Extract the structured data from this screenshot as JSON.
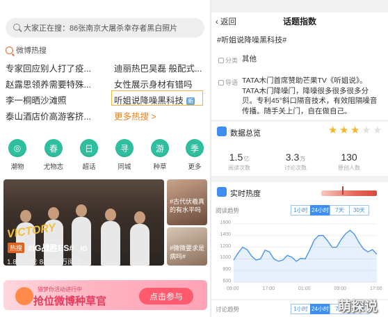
{
  "left": {
    "search_text": "大家正在搜：86张南京大屠杀幸存者黑白照片",
    "hot_header": "微博热搜",
    "hot_items": [
      "专家回应别人打了疫...",
      "迪丽热巴吴磊 般配式...",
      "赵露思领养需要特殊...",
      "女性展示身材有错吗",
      "李一桐晒沙滩照",
      "听姐说降噪黑科技",
      "泰山酒店价高游客挤...",
      "更多热搜 >"
    ],
    "new_badge": "新",
    "categories": [
      {
        "glyph": "◎",
        "label": "潮物"
      },
      {
        "glyph": "春",
        "label": "尤物志"
      },
      {
        "glyph": "日",
        "label": "超话"
      },
      {
        "glyph": "寻",
        "label": "同城"
      },
      {
        "glyph": "游",
        "label": "种草"
      },
      {
        "glyph": "季",
        "label": "更多"
      }
    ],
    "feed": {
      "watermark": "VICTORY",
      "tag": "热搜",
      "title": "#iG战胜ES#",
      "logo": "IG",
      "stats": "1.8万讨论   8428.9万阅读"
    },
    "side1_text": "#古代伏羲真的有水平吗",
    "side2_text": "#微微要求是病吗#",
    "banner": {
      "small": "猎梦你活动进行中",
      "big": "抢位微博种草官",
      "button": "点击参与"
    }
  },
  "right": {
    "back": "返回",
    "nav_title": "话题指数",
    "topic": "#听姐说降噪黑科技#",
    "category_label": "分类",
    "category_value": "其他",
    "guide_label": "导语",
    "guide_text": "TATA木门首席赞助芒果TV《听姐说》。TATA木门降噪门，降噪很多很多很多分贝。专利45°斜口隔音技术，有效阻隔噪音传播。随手关上门，自在做自己。",
    "overview_title": "数据总览",
    "stars": 3,
    "stars_max": 5,
    "stats": [
      {
        "value": "1.5",
        "unit": "亿",
        "label": "阅读次数"
      },
      {
        "value": "3.3",
        "unit": "万",
        "label": "讨论次数"
      },
      {
        "value": "130",
        "unit": "",
        "label": "原创人数"
      }
    ],
    "heat_title": "实时热度",
    "read_trend_label": "阅读趋势",
    "discuss_trend_label": "讨论趋势",
    "tabs": [
      "1小时",
      "24小时",
      "7天",
      "30天"
    ],
    "active_tab": 1,
    "accent": "#3d8ef0",
    "watermark": "萌探说",
    "chart_data": {
      "type": "line",
      "x": [
        "09:00",
        "10:00",
        "11:00",
        "12:00",
        "13:00",
        "14:00",
        "15:00",
        "16:00",
        "17:00",
        "18:00",
        "19:00",
        "20:00",
        "21:00",
        "22:00",
        "23:00",
        "00:00",
        "01:00",
        "02:00",
        "03:00",
        "04:00",
        "05:00",
        "06:00",
        "07:00",
        "08:00",
        "09:00",
        "10:00",
        "11:00",
        "12:00",
        "13:00",
        "14:00",
        "15:00",
        "16:00",
        "17:00"
      ],
      "xticks": [
        "09:00",
        "",
        "",
        "",
        "",
        "",
        "",
        "",
        "17:00",
        "",
        "",
        "",
        "",
        "",
        "",
        "",
        "01:00",
        "",
        "",
        "",
        "",
        "",
        "",
        "",
        "09:00",
        "",
        "",
        "",
        "",
        "",
        "",
        "",
        "17:00"
      ],
      "values": [
        980,
        1100,
        1200,
        1160,
        1050,
        980,
        1000,
        1150,
        1120,
        1000,
        960,
        980,
        1060,
        1030,
        960,
        1010,
        1000,
        1150,
        1320,
        1400,
        1400,
        1310,
        1200,
        1200,
        1330,
        1430,
        1490,
        1420,
        1280,
        1170,
        1120,
        1160,
        1080
      ],
      "ylim": [
        600,
        1600
      ],
      "yticks": [
        600,
        800,
        1000,
        1200,
        1400,
        1600
      ]
    }
  }
}
